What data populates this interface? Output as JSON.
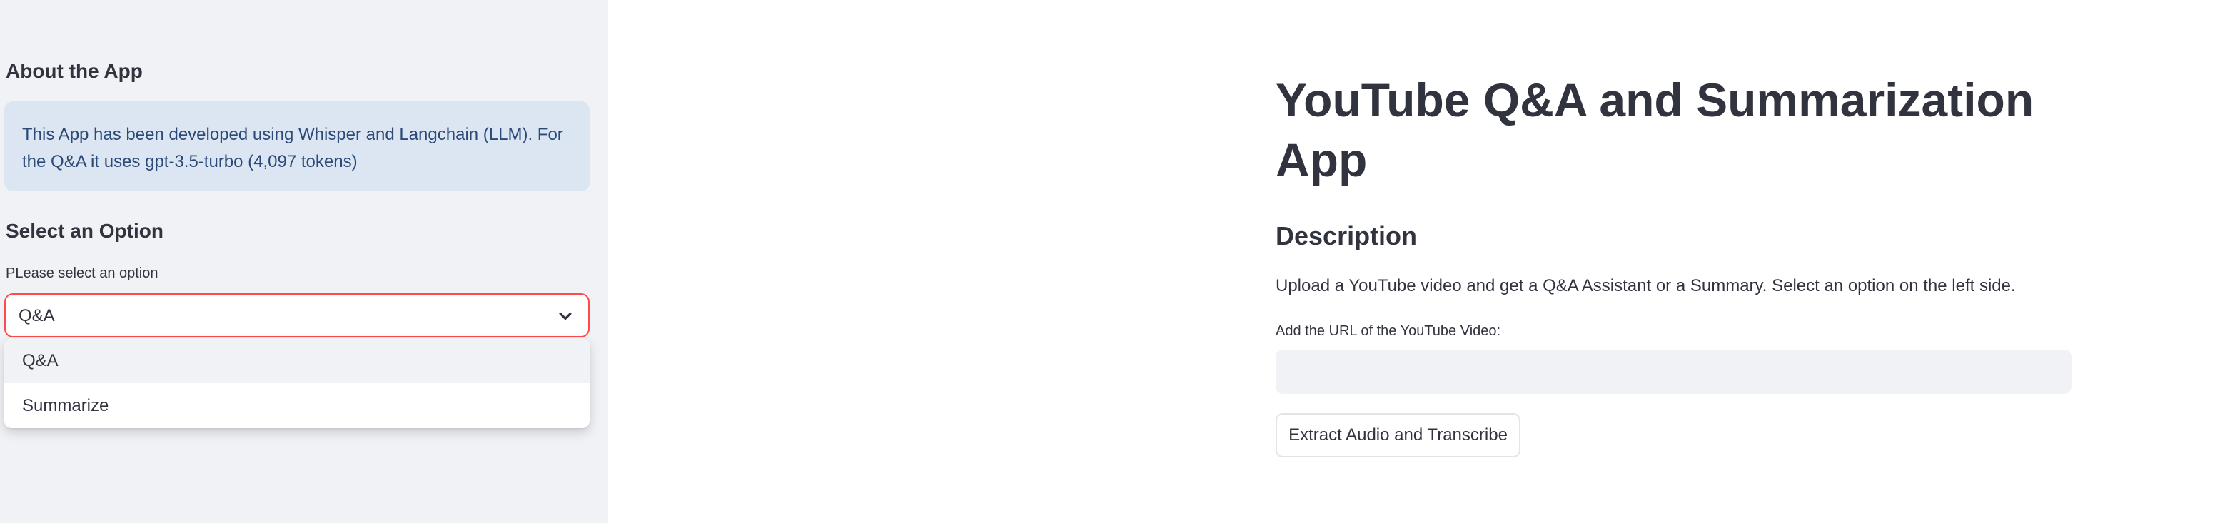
{
  "sidebar": {
    "about_heading": "About the App",
    "info_text": "This App has been developed using Whisper and Langchain (LLM). For the Q&A it uses gpt-3.5-turbo (4,097 tokens)",
    "option_heading": "Select an Option",
    "select_label": "PLease select an option",
    "select_value": "Q&A",
    "options": [
      {
        "label": "Q&A"
      },
      {
        "label": "Summarize"
      }
    ],
    "select_border_color": "#ff4b4b",
    "chevron_icon": "chevron-down-icon"
  },
  "main": {
    "title": "YouTube Q&A and Summarization App",
    "subtitle": "Description",
    "description": "Upload a YouTube video and get a Q&A Assistant or a Summary. Select an option on the left side.",
    "url_label": "Add the URL of the YouTube Video:",
    "url_value": "",
    "button_label": "Extract Audio and Transcribe"
  }
}
